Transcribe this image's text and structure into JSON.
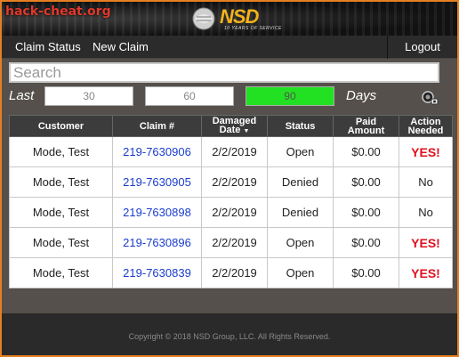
{
  "watermark": "hack-cheat.org",
  "brand": {
    "name": "NSD",
    "tagline": "10 YEARS OF SERVICE",
    "accent_color": "#f3b21b"
  },
  "nav": {
    "claim_status": "Claim Status",
    "new_claim": "New Claim",
    "logout": "Logout"
  },
  "search": {
    "placeholder": "Search",
    "value": ""
  },
  "filter": {
    "last_label": "Last",
    "days_label": "Days",
    "options": [
      "30",
      "60",
      "90"
    ],
    "selected": "90",
    "active_color": "#22e022"
  },
  "table": {
    "headers": {
      "customer": "Customer",
      "claim": "Claim #",
      "damaged_date_1": "Damaged",
      "damaged_date_2": "Date",
      "status": "Status",
      "paid_1": "Paid",
      "paid_2": "Amount",
      "action_1": "Action",
      "action_2": "Needed"
    },
    "sort_indicator": "▼",
    "rows": [
      {
        "customer": "Mode, Test",
        "claim": "219-7630906",
        "date": "2/2/2019",
        "status": "Open",
        "paid": "$0.00",
        "action": "YES!"
      },
      {
        "customer": "Mode, Test",
        "claim": "219-7630905",
        "date": "2/2/2019",
        "status": "Denied",
        "paid": "$0.00",
        "action": "No"
      },
      {
        "customer": "Mode, Test",
        "claim": "219-7630898",
        "date": "2/2/2019",
        "status": "Denied",
        "paid": "$0.00",
        "action": "No"
      },
      {
        "customer": "Mode, Test",
        "claim": "219-7630896",
        "date": "2/2/2019",
        "status": "Open",
        "paid": "$0.00",
        "action": "YES!"
      },
      {
        "customer": "Mode, Test",
        "claim": "219-7630839",
        "date": "2/2/2019",
        "status": "Open",
        "paid": "$0.00",
        "action": "YES!"
      }
    ]
  },
  "icons": {
    "settings": "camera-gear-icon"
  },
  "footer": {
    "copyright": "Copyright © 2018 NSD Group, LLC. All Rights Reserved."
  }
}
